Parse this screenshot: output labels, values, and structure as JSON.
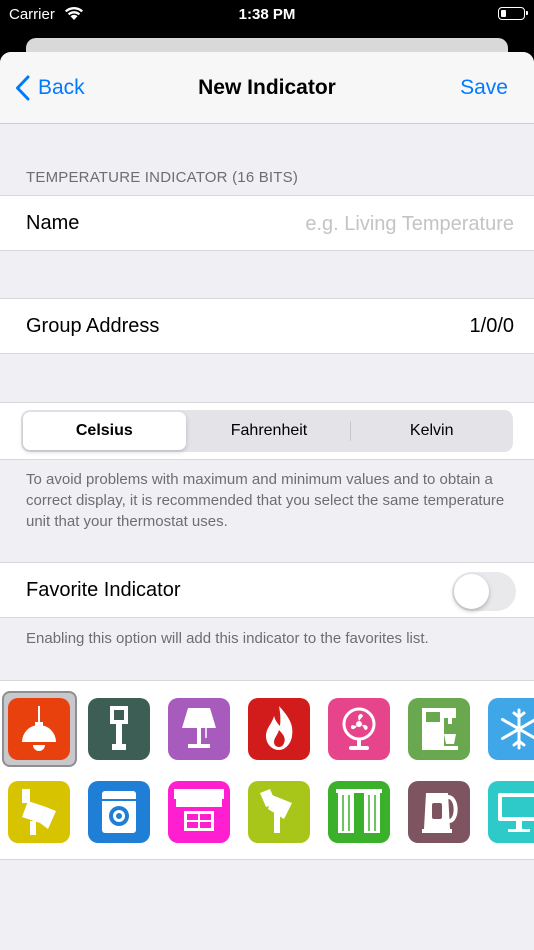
{
  "status_bar": {
    "carrier": "Carrier",
    "time": "1:38 PM"
  },
  "navbar": {
    "back_label": "Back",
    "title": "New Indicator",
    "save_label": "Save"
  },
  "section": {
    "header": "TEMPERATURE INDICATOR (16 BITS)"
  },
  "name_field": {
    "label": "Name",
    "value": "",
    "placeholder": "e.g. Living Temperature"
  },
  "group_address": {
    "label": "Group Address",
    "value": "1/0/0"
  },
  "unit_selector": {
    "options": [
      "Celsius",
      "Fahrenheit",
      "Kelvin"
    ],
    "selected": "Celsius",
    "footnote": "To avoid problems with maximum and minimum values and to obtain a correct display, it is recommended that you select the same temperature unit that your thermostat uses."
  },
  "favorite": {
    "label": "Favorite Indicator",
    "enabled": false,
    "footnote": "Enabling this option will add this indicator to the favorites list."
  },
  "icons": [
    {
      "name": "ceiling-lamp-icon",
      "color": "#e8410e",
      "selected": true
    },
    {
      "name": "street-lamp-icon",
      "color": "#3d5e55"
    },
    {
      "name": "table-lamp-icon",
      "color": "#a65bbd"
    },
    {
      "name": "fire-icon",
      "color": "#d21b1b"
    },
    {
      "name": "fan-icon",
      "color": "#e6458b"
    },
    {
      "name": "coffee-machine-icon",
      "color": "#6aa84f"
    },
    {
      "name": "snowflake-icon",
      "color": "#3fa7e8"
    },
    {
      "name": "spotlight-icon",
      "color": "#d7c300"
    },
    {
      "name": "washing-machine-icon",
      "color": "#1f7fd6"
    },
    {
      "name": "awning-window-icon",
      "color": "#ff1fd1"
    },
    {
      "name": "spotlight-tilted-icon",
      "color": "#a7c619"
    },
    {
      "name": "curtains-icon",
      "color": "#3bb02b"
    },
    {
      "name": "kettle-icon",
      "color": "#7d5460"
    },
    {
      "name": "monitor-icon",
      "color": "#2ec9c9"
    }
  ]
}
